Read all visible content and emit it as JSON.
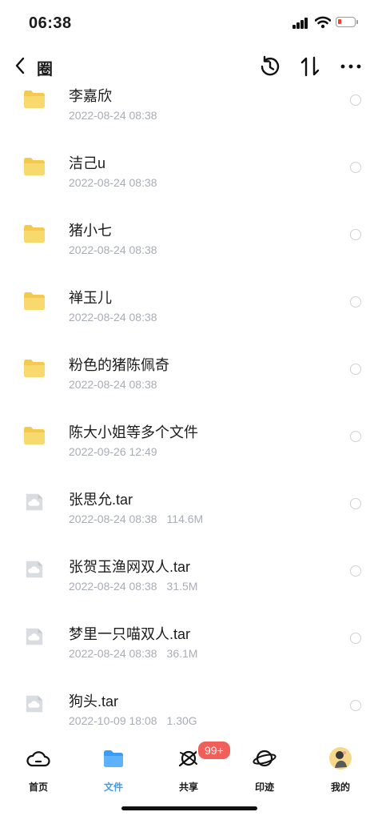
{
  "status_bar": {
    "time": "06:38"
  },
  "header": {
    "title": "圈",
    "icons": [
      "back-chevron-icon",
      "history-icon",
      "sort-icon",
      "more-icon"
    ]
  },
  "files": [
    {
      "type": "folder",
      "name": "李嘉欣",
      "date": "2022-08-24 08:38",
      "size": ""
    },
    {
      "type": "folder",
      "name": "洁己u",
      "date": "2022-08-24 08:38",
      "size": ""
    },
    {
      "type": "folder",
      "name": "猪小七",
      "date": "2022-08-24 08:38",
      "size": ""
    },
    {
      "type": "folder",
      "name": "禅玉儿",
      "date": "2022-08-24 08:38",
      "size": ""
    },
    {
      "type": "folder",
      "name": "粉色的猪陈佩奇",
      "date": "2022-08-24 08:38",
      "size": ""
    },
    {
      "type": "folder",
      "name": "陈大小姐等多个文件",
      "date": "2022-09-26 12:49",
      "size": ""
    },
    {
      "type": "file",
      "name": "张思允.tar",
      "date": "2022-08-24 08:38",
      "size": "114.6M"
    },
    {
      "type": "file",
      "name": "张贺玉渔网双人.tar",
      "date": "2022-08-24 08:38",
      "size": "31.5M"
    },
    {
      "type": "file",
      "name": "梦里一只喵双人.tar",
      "date": "2022-08-24 08:38",
      "size": "36.1M"
    },
    {
      "type": "file",
      "name": "狗头.tar",
      "date": "2022-10-09 18:08",
      "size": "1.30G"
    }
  ],
  "tabbar": {
    "tabs": [
      {
        "label": "首页",
        "icon": "home-cloud-icon",
        "active": false
      },
      {
        "label": "文件",
        "icon": "folder-icon",
        "active": true
      },
      {
        "label": "共享",
        "icon": "planet-share-icon",
        "active": false
      },
      {
        "label": "印迹",
        "icon": "planet-icon",
        "active": false
      },
      {
        "label": "我的",
        "icon": "avatar",
        "active": false
      }
    ],
    "share_badge": "99+"
  },
  "colors": {
    "accent": "#3b9cf5",
    "folder": "#f8d56a",
    "badge": "#f0605b",
    "meta": "#a8adb5"
  }
}
